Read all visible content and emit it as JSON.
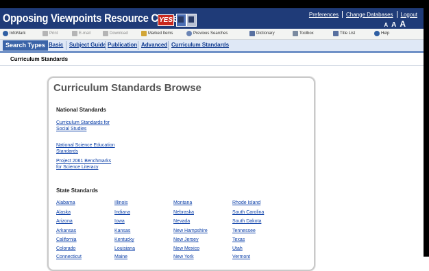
{
  "header": {
    "title": "Opposing Viewpoints Resource Center",
    "logo_text": "YES",
    "links": [
      "Preferences",
      "Change Databases",
      "Logout"
    ],
    "font_sizes": [
      "A",
      "A",
      "A"
    ]
  },
  "toolbar": [
    {
      "label": "InfoMark",
      "icon": "infomark-icon",
      "enabled": true
    },
    {
      "label": "Print",
      "icon": "print-icon",
      "enabled": false
    },
    {
      "label": "E-mail",
      "icon": "email-icon",
      "enabled": false
    },
    {
      "label": "Download",
      "icon": "download-icon",
      "enabled": false
    },
    {
      "label": "Marked Items",
      "icon": "marked-items-icon",
      "enabled": true
    },
    {
      "label": "Previous Searches",
      "icon": "previous-searches-icon",
      "enabled": true
    },
    {
      "label": "Dictionary",
      "icon": "dictionary-icon",
      "enabled": true
    },
    {
      "label": "Toolbox",
      "icon": "toolbox-icon",
      "enabled": true
    },
    {
      "label": "Title List",
      "icon": "title-list-icon",
      "enabled": true
    },
    {
      "label": "Help",
      "icon": "help-icon",
      "enabled": true
    }
  ],
  "search_types": {
    "heading": "Search Types",
    "tabs": [
      "Basic",
      "Subject Guide",
      "Publication",
      "Advanced",
      "Curriculum Standards"
    ]
  },
  "breadcrumb": "Curriculum Standards",
  "browse": {
    "title": "Curriculum Standards Browse",
    "national_heading": "National Standards",
    "national_links": [
      "Curriculum Standards for Social Studies",
      "National Science Education Standards",
      "Project 2061 Benchmarks for Science Literacy"
    ],
    "state_heading": "State Standards",
    "state_columns": [
      [
        "Alabama",
        "Alaska",
        "Arizona",
        "Arkansas",
        "California",
        "Colorado",
        "Connecticut"
      ],
      [
        "Illinois",
        "Indiana",
        "Iowa",
        "Kansas",
        "Kentucky",
        "Louisiana",
        "Maine"
      ],
      [
        "Montana",
        "Nebraska",
        "Nevada",
        "New Hampshire",
        "New Jersey",
        "New Mexico",
        "New York"
      ],
      [
        "Rhode Island",
        "South Carolina",
        "South Dakota",
        "Tennessee",
        "Texas",
        "Utah",
        "Vermont"
      ]
    ]
  },
  "colors": {
    "header_bg": "#1f3b78",
    "tab_head_bg": "#3b64a8",
    "link": "#0b3fa8"
  }
}
